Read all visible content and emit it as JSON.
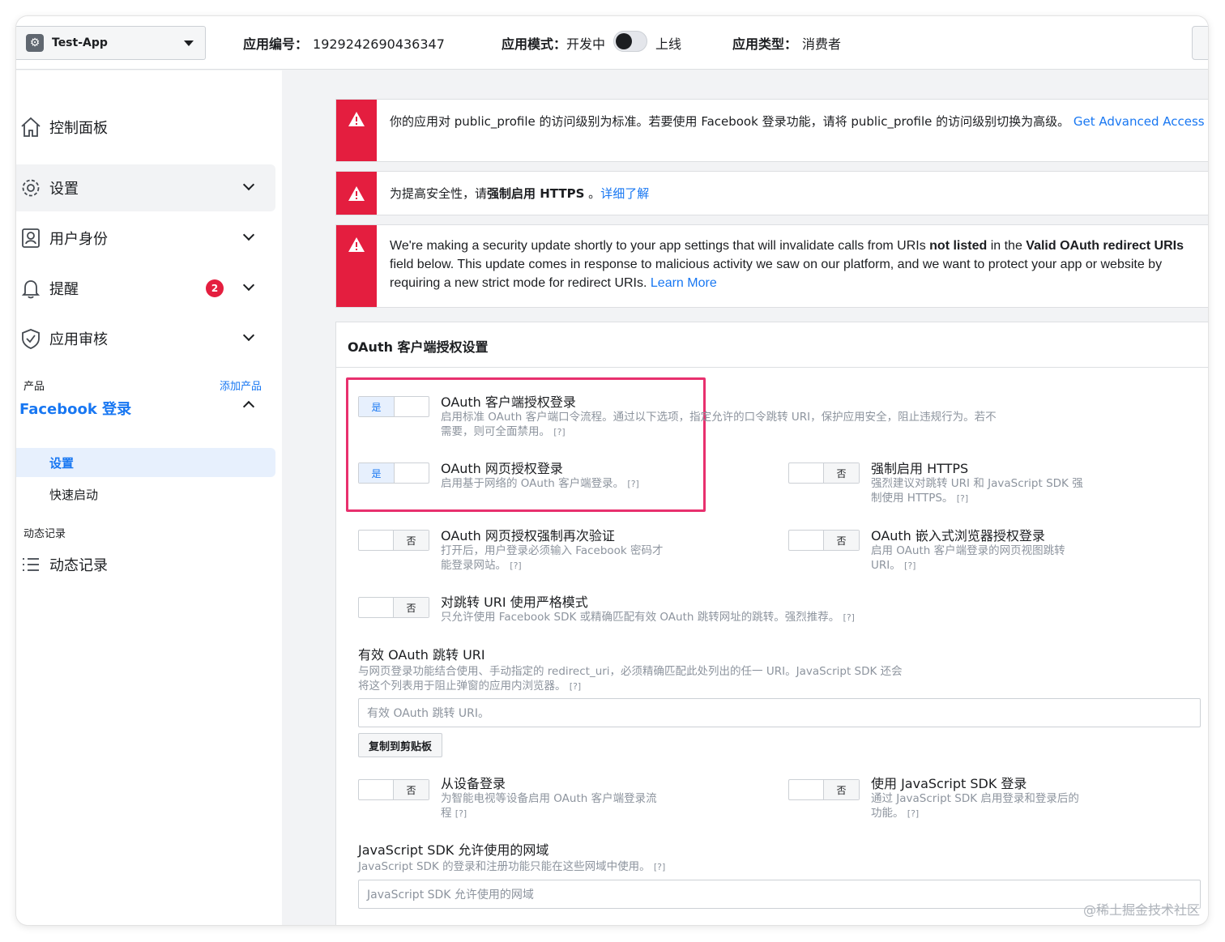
{
  "topbar": {
    "app_name": "Test-App",
    "app_id_label": "应用编号：",
    "app_id": "1929242690436347",
    "mode_label": "应用模式：",
    "mode_dev": "开发中",
    "mode_live": "上线",
    "type_label": "应用类型：",
    "type_value": "消费者"
  },
  "sidebar": {
    "items": [
      {
        "label": "控制面板"
      },
      {
        "label": "设置"
      },
      {
        "label": "用户身份"
      },
      {
        "label": "提醒",
        "badge": "2"
      },
      {
        "label": "应用审核"
      }
    ],
    "products_label": "产品",
    "add_product": "添加产品",
    "facebook_login": "Facebook 登录",
    "sub_items": [
      "设置",
      "快速启动"
    ],
    "activity_section": "动态记录",
    "activity_item": "动态记录"
  },
  "alerts": [
    {
      "text": "你的应用对 public_profile 的访问级别为标准。若要使用 Facebook 登录功能，请将 public_profile 的访问级别切换为高级。",
      "link": "Get Advanced Access"
    },
    {
      "text_pre": "为提高安全性，请",
      "text_bold": "强制启用 HTTPS",
      "text_post": " 。",
      "link": "详细了解"
    },
    {
      "p1": "We're making a security update shortly to your app settings that will invalidate calls from URIs ",
      "b1": "not listed",
      "p2": " in the ",
      "b2": "Valid OAuth redirect URIs",
      "p3": " field below. This update comes in response to malicious activity we saw on our platform, and we want to protect your app or website by requiring a new strict mode for redirect URIs. ",
      "link": "Learn More"
    }
  ],
  "card": {
    "title": "OAuth 客户端授权设置",
    "help": "[?]",
    "options": {
      "client_oauth": {
        "toggle": "是",
        "title": "OAuth 客户端授权登录",
        "desc": "启用标准 OAuth 客户端口令流程。通过以下选项，指定允许的口令跳转 URI，保护应用安全，阻止违规行为。若不需要，则可全面禁用。"
      },
      "web_oauth": {
        "toggle": "是",
        "title": "OAuth 网页授权登录",
        "desc": "启用基于网络的 OAuth 客户端登录。"
      },
      "force_https": {
        "toggle": "否",
        "title": "强制启用 HTTPS",
        "desc": "强烈建议对跳转 URI 和 JavaScript SDK 强制使用 HTTPS。"
      },
      "reauth": {
        "toggle": "否",
        "title": "OAuth 网页授权强制再次验证",
        "desc": "打开后，用户登录必须输入 Facebook 密码才能登录网站。"
      },
      "embedded": {
        "toggle": "否",
        "title": "OAuth 嵌入式浏览器授权登录",
        "desc": "启用 OAuth 客户端登录的网页视图跳转 URI。"
      },
      "strict": {
        "toggle": "否",
        "title": "对跳转 URI 使用严格模式",
        "desc": "只允许使用 Facebook SDK 或精确匹配有效 OAuth 跳转网址的跳转。强烈推荐。"
      },
      "device": {
        "toggle": "否",
        "title": "从设备登录",
        "desc": "为智能电视等设备启用 OAuth 客户端登录流程"
      },
      "js_sdk": {
        "toggle": "否",
        "title": "使用 JavaScript SDK 登录",
        "desc": "通过 JavaScript SDK 启用登录和登录后的功能。"
      }
    },
    "redirect": {
      "title": "有效 OAuth 跳转 URI",
      "desc": "与网页登录功能结合使用、手动指定的 redirect_uri，必须精确匹配此处列出的任一 URI。JavaScript SDK 还会将这个列表用于阻止弹窗的应用内浏览器。",
      "placeholder": "有效 OAuth 跳转 URI。",
      "copy": "复制到剪贴板"
    },
    "domains": {
      "title": "JavaScript SDK 允许使用的网域",
      "desc": "JavaScript SDK 的登录和注册功能只能在这些网域中使用。",
      "placeholder": "JavaScript SDK 允许使用的网域"
    }
  },
  "watermark": "@稀土掘金技术社区",
  "colors": {
    "accent": "#1877f2",
    "alert": "#e41e3f",
    "highlight": "#e8306e"
  }
}
